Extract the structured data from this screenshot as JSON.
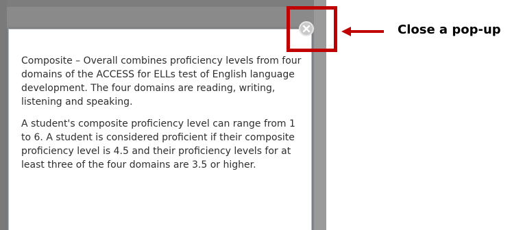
{
  "modal": {
    "paragraphs": [
      "Composite – Overall combines proficiency levels from four domains of the ACCESS for ELLs test of English language development. The four domains are reading, writing, listening and speaking.",
      "A student's composite proficiency level can range from 1 to 6. A student is considered proficient if their composite proficiency level is 4.5 and their proficiency levels for at least three of the four domains are 3.5 or higher."
    ],
    "close_icon": "close-circle-x-icon"
  },
  "annotation": {
    "callout_text": "Close a pop-up",
    "highlight_color": "#c00000",
    "arrow_color": "#c00000"
  },
  "colors": {
    "overlay": "#8a8a8a",
    "modal_background": "#ffffff",
    "close_button": "#c9c9c9"
  }
}
